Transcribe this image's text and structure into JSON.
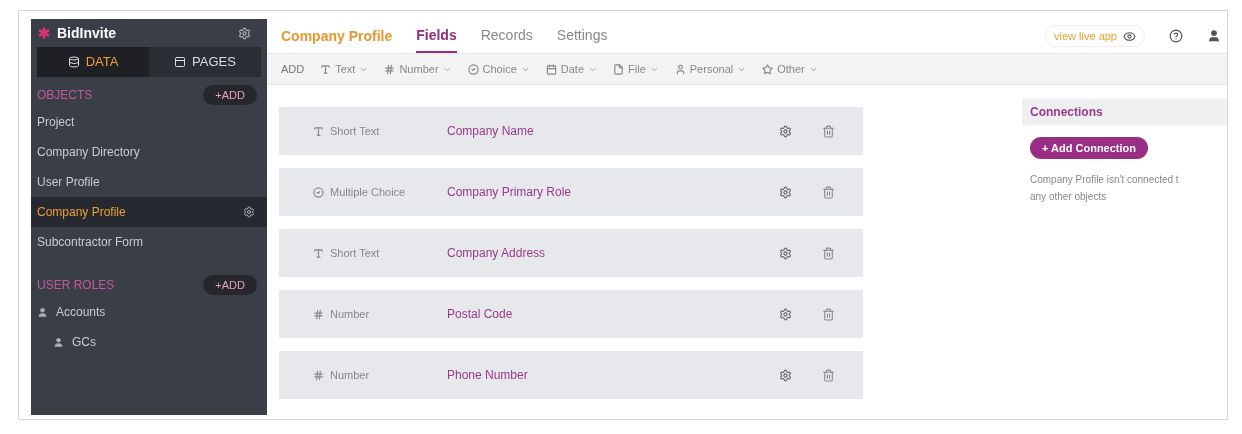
{
  "sidebar": {
    "app_name": "BidInvite",
    "tabs": [
      {
        "label": "DATA",
        "kind": "data",
        "selected": true
      },
      {
        "label": "PAGES",
        "kind": "pages",
        "selected": false
      }
    ],
    "sections": [
      {
        "title": "OBJECTS",
        "add_label": "+ADD",
        "items": [
          {
            "label": "Project",
            "selected": false
          },
          {
            "label": "Company Directory",
            "selected": false
          },
          {
            "label": "User Profile",
            "selected": false
          },
          {
            "label": "Company Profile",
            "selected": true
          },
          {
            "label": "Subcontractor Form",
            "selected": false
          }
        ]
      },
      {
        "title": "USER ROLES",
        "add_label": "+ADD",
        "items": [
          {
            "label": "Accounts",
            "selected": false,
            "children": [
              {
                "label": "GCs",
                "selected": false
              }
            ]
          }
        ]
      }
    ]
  },
  "header": {
    "object_title": "Company Profile",
    "tabs": [
      {
        "label": "Fields",
        "selected": true
      },
      {
        "label": "Records",
        "selected": false
      },
      {
        "label": "Settings",
        "selected": false
      }
    ],
    "live_app_label": "view live app"
  },
  "toolbar": {
    "add_label": "ADD",
    "types": [
      {
        "label": "Text",
        "kind": "text"
      },
      {
        "label": "Number",
        "kind": "number"
      },
      {
        "label": "Choice",
        "kind": "choice"
      },
      {
        "label": "Date",
        "kind": "date"
      },
      {
        "label": "File",
        "kind": "file"
      },
      {
        "label": "Personal",
        "kind": "personal"
      },
      {
        "label": "Other",
        "kind": "other"
      }
    ]
  },
  "fields": [
    {
      "type_label": "Short Text",
      "kind": "text",
      "name": "Company Name"
    },
    {
      "type_label": "Multiple Choice",
      "kind": "choice",
      "name": "Company Primary Role"
    },
    {
      "type_label": "Short Text",
      "kind": "text",
      "name": "Company Address"
    },
    {
      "type_label": "Number",
      "kind": "number",
      "name": "Postal Code"
    },
    {
      "type_label": "Number",
      "kind": "number",
      "name": "Phone Number"
    }
  ],
  "connections": {
    "title": "Connections",
    "add_label": "+ Add Connection",
    "note_lines": [
      "Company Profile isn't connected t",
      "any other objects"
    ]
  }
}
